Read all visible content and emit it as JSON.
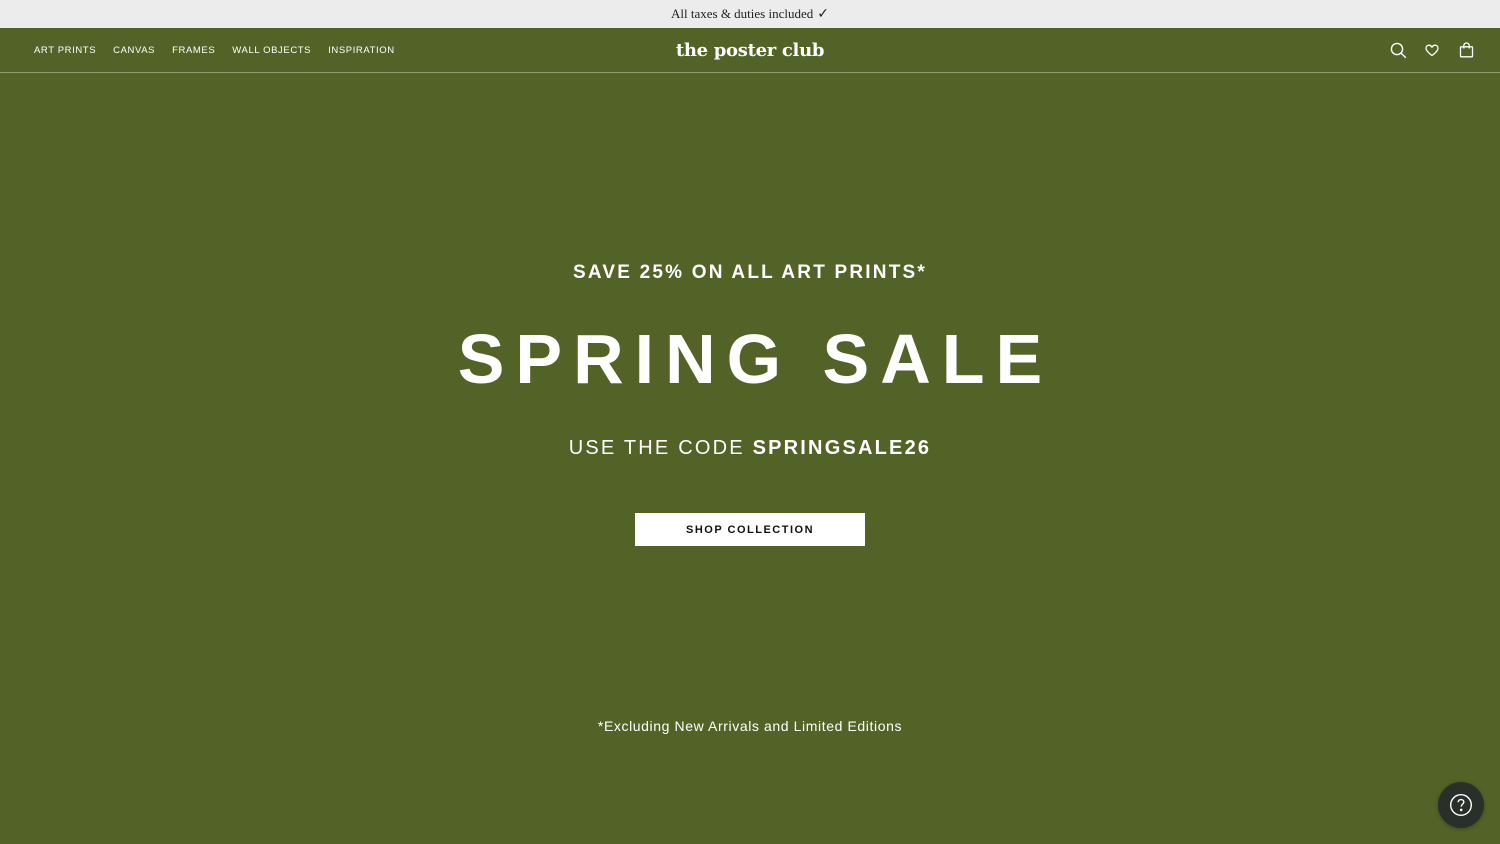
{
  "announcement": {
    "text": "All taxes & duties included",
    "check_glyph": "✓",
    "check_icon": "checkmark-icon"
  },
  "nav": {
    "links": [
      "ART PRINTS",
      "CANVAS",
      "FRAMES",
      "WALL OBJECTS",
      "INSPIRATION"
    ],
    "logo": "the poster club",
    "icons": [
      "search-icon",
      "heart-icon",
      "shopping-bag-icon"
    ]
  },
  "hero": {
    "eyebrow": "SAVE 25% ON ALL ART PRINTS*",
    "headline": "SPRING SALE",
    "code_prefix": "USE THE CODE ",
    "code": "SPRINGSALE26",
    "cta_label": "SHOP COLLECTION",
    "disclaimer": "*Excluding New Arrivals and Limited Editions"
  },
  "help_button": {
    "icon": "question-mark-icon"
  },
  "colors": {
    "background": "#536327",
    "announcement_bar": "#ececec",
    "help_button": "#2b2f2a",
    "text": "#ffffff"
  }
}
